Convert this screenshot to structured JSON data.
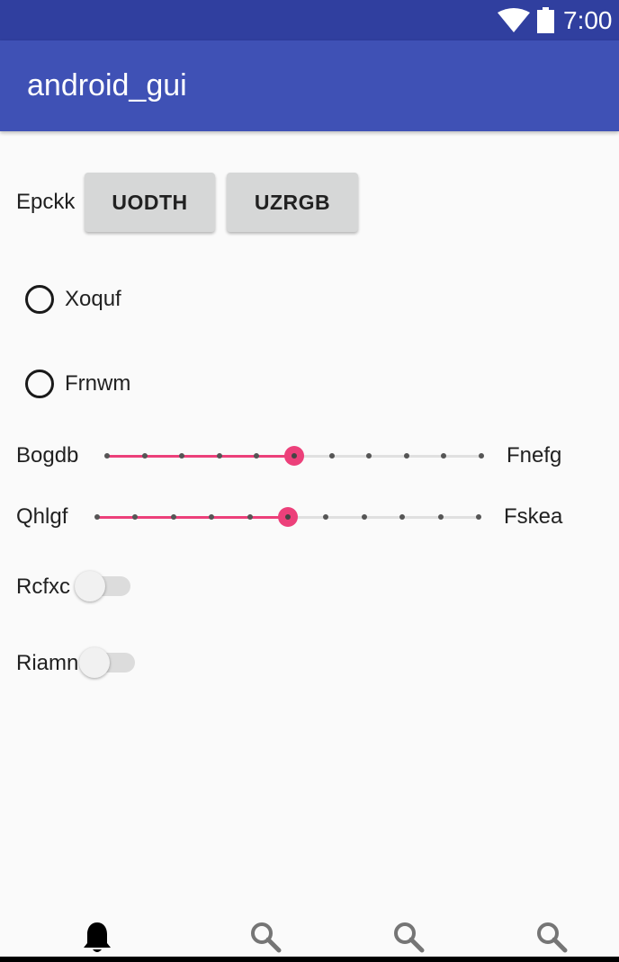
{
  "status_bar": {
    "time": "7:00",
    "icons": [
      "wifi-icon",
      "battery-icon"
    ]
  },
  "app_bar": {
    "title": "android_gui"
  },
  "button_row": {
    "label": "Epckk",
    "buttons": [
      "UODTH",
      "UZRGB"
    ]
  },
  "radios": [
    {
      "label": "Xoquf",
      "checked": false
    },
    {
      "label": "Frnwm",
      "checked": false
    }
  ],
  "sliders": [
    {
      "start_label": "Bogdb",
      "end_label": "Fnefg",
      "value": 5,
      "max": 10
    },
    {
      "start_label": "Qhlgf",
      "end_label": "Fskea",
      "value": 5,
      "max": 10
    }
  ],
  "switches": [
    {
      "label": "Rcfxc",
      "on": false
    },
    {
      "label": "Riamn",
      "on": false
    }
  ],
  "colors": {
    "status_bar": "#303f9f",
    "app_bar": "#3f51b5",
    "accent": "#ec407a"
  },
  "bottom_nav": {
    "items": [
      "bell-icon",
      "search-icon",
      "search-icon",
      "search-icon"
    ],
    "selected": 0
  }
}
